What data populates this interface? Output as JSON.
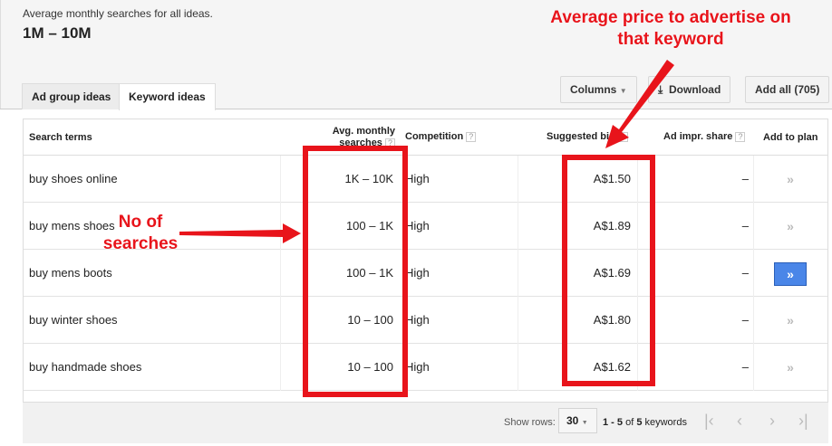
{
  "header": {
    "subtitle": "Average monthly searches for all ideas.",
    "range": "1M – 10M"
  },
  "tabs": [
    {
      "label": "Ad group ideas"
    },
    {
      "label": "Keyword ideas",
      "active": true
    }
  ],
  "toolbar": {
    "columns": "Columns",
    "download": "Download",
    "add_all": "Add all (705)"
  },
  "table": {
    "headers": {
      "terms": "Search terms",
      "avg": "Avg. monthly searches",
      "competition": "Competition",
      "bid": "Suggested bid",
      "impr": "Ad impr. share",
      "plan": "Add to plan"
    },
    "rows": [
      {
        "term": "buy shoes online",
        "searches": "1K – 10K",
        "competition": "High",
        "bid": "A$1.50",
        "share": "–",
        "added": false
      },
      {
        "term": "buy mens shoes",
        "searches": "100 – 1K",
        "competition": "High",
        "bid": "A$1.89",
        "share": "–",
        "added": false
      },
      {
        "term": "buy mens boots",
        "searches": "100 – 1K",
        "competition": "High",
        "bid": "A$1.69",
        "share": "–",
        "added": true
      },
      {
        "term": "buy winter shoes",
        "searches": "10 – 100",
        "competition": "High",
        "bid": "A$1.80",
        "share": "–",
        "added": false
      },
      {
        "term": "buy handmade shoes",
        "searches": "10 – 100",
        "competition": "High",
        "bid": "A$1.62",
        "share": "–",
        "added": false
      }
    ]
  },
  "footer": {
    "show_rows": "Show rows:",
    "rows_value": "30",
    "range_a": "1 - 5",
    "of": " of ",
    "range_b": "5",
    "keywords": " keywords"
  },
  "annotations": {
    "price": "Average price to advertise on that keyword",
    "searches": "No of searches",
    "color": "#e8141b"
  }
}
